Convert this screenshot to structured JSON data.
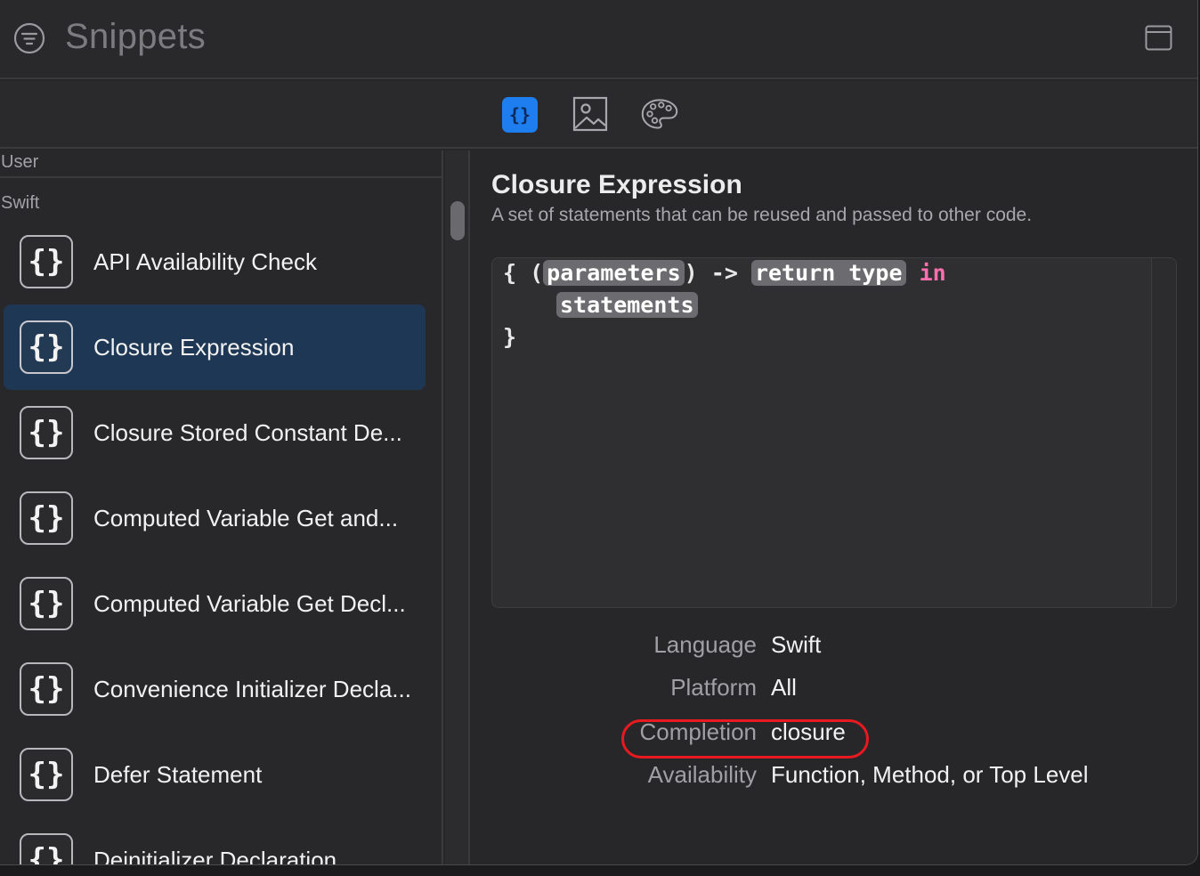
{
  "window": {
    "title": "Snippets",
    "filter_icon": "filter-circle-icon",
    "layout_icon": "window-layout-icon"
  },
  "toolbar": {
    "tabs": [
      {
        "name": "code",
        "icon": "curly-braces-icon",
        "selected": true
      },
      {
        "name": "image",
        "icon": "image-icon",
        "selected": false
      },
      {
        "name": "palette",
        "icon": "palette-icon",
        "selected": false
      }
    ],
    "accent": "#1e7ef0"
  },
  "sidebar": {
    "section_user": "User",
    "section_swift": "Swift",
    "items": [
      {
        "label": "API Availability Check",
        "icon": "{}"
      },
      {
        "label": "Closure Expression",
        "icon": "{}",
        "selected": true
      },
      {
        "label": "Closure Stored Constant De...",
        "icon": "{}"
      },
      {
        "label": "Computed Variable Get and...",
        "icon": "{}"
      },
      {
        "label": "Computed Variable Get Decl...",
        "icon": "{}"
      },
      {
        "label": "Convenience Initializer Decla...",
        "icon": "{}"
      },
      {
        "label": "Defer Statement",
        "icon": "{}"
      },
      {
        "label": "Deinitializer Declaration",
        "icon": "{}"
      }
    ],
    "selected_color": "#1e3754"
  },
  "detail": {
    "title": "Closure Expression",
    "subtitle": "A set of statements that can be reused and passed to other code.",
    "code": {
      "open_brace": "{ (",
      "parameters": "parameters",
      "arrow": ") -> ",
      "return_type": "return type",
      "keyword_in": "in",
      "statements": "statements",
      "close_brace": "}"
    },
    "meta": {
      "language_label": "Language",
      "language_value": "Swift",
      "platform_label": "Platform",
      "platform_value": "All",
      "completion_label": "Completion",
      "completion_value": "closure",
      "availability_label": "Availability",
      "availability_value": "Function, Method, or Top Level"
    },
    "keyword_color": "#ff6fae",
    "annotation_color": "#e8191f"
  }
}
